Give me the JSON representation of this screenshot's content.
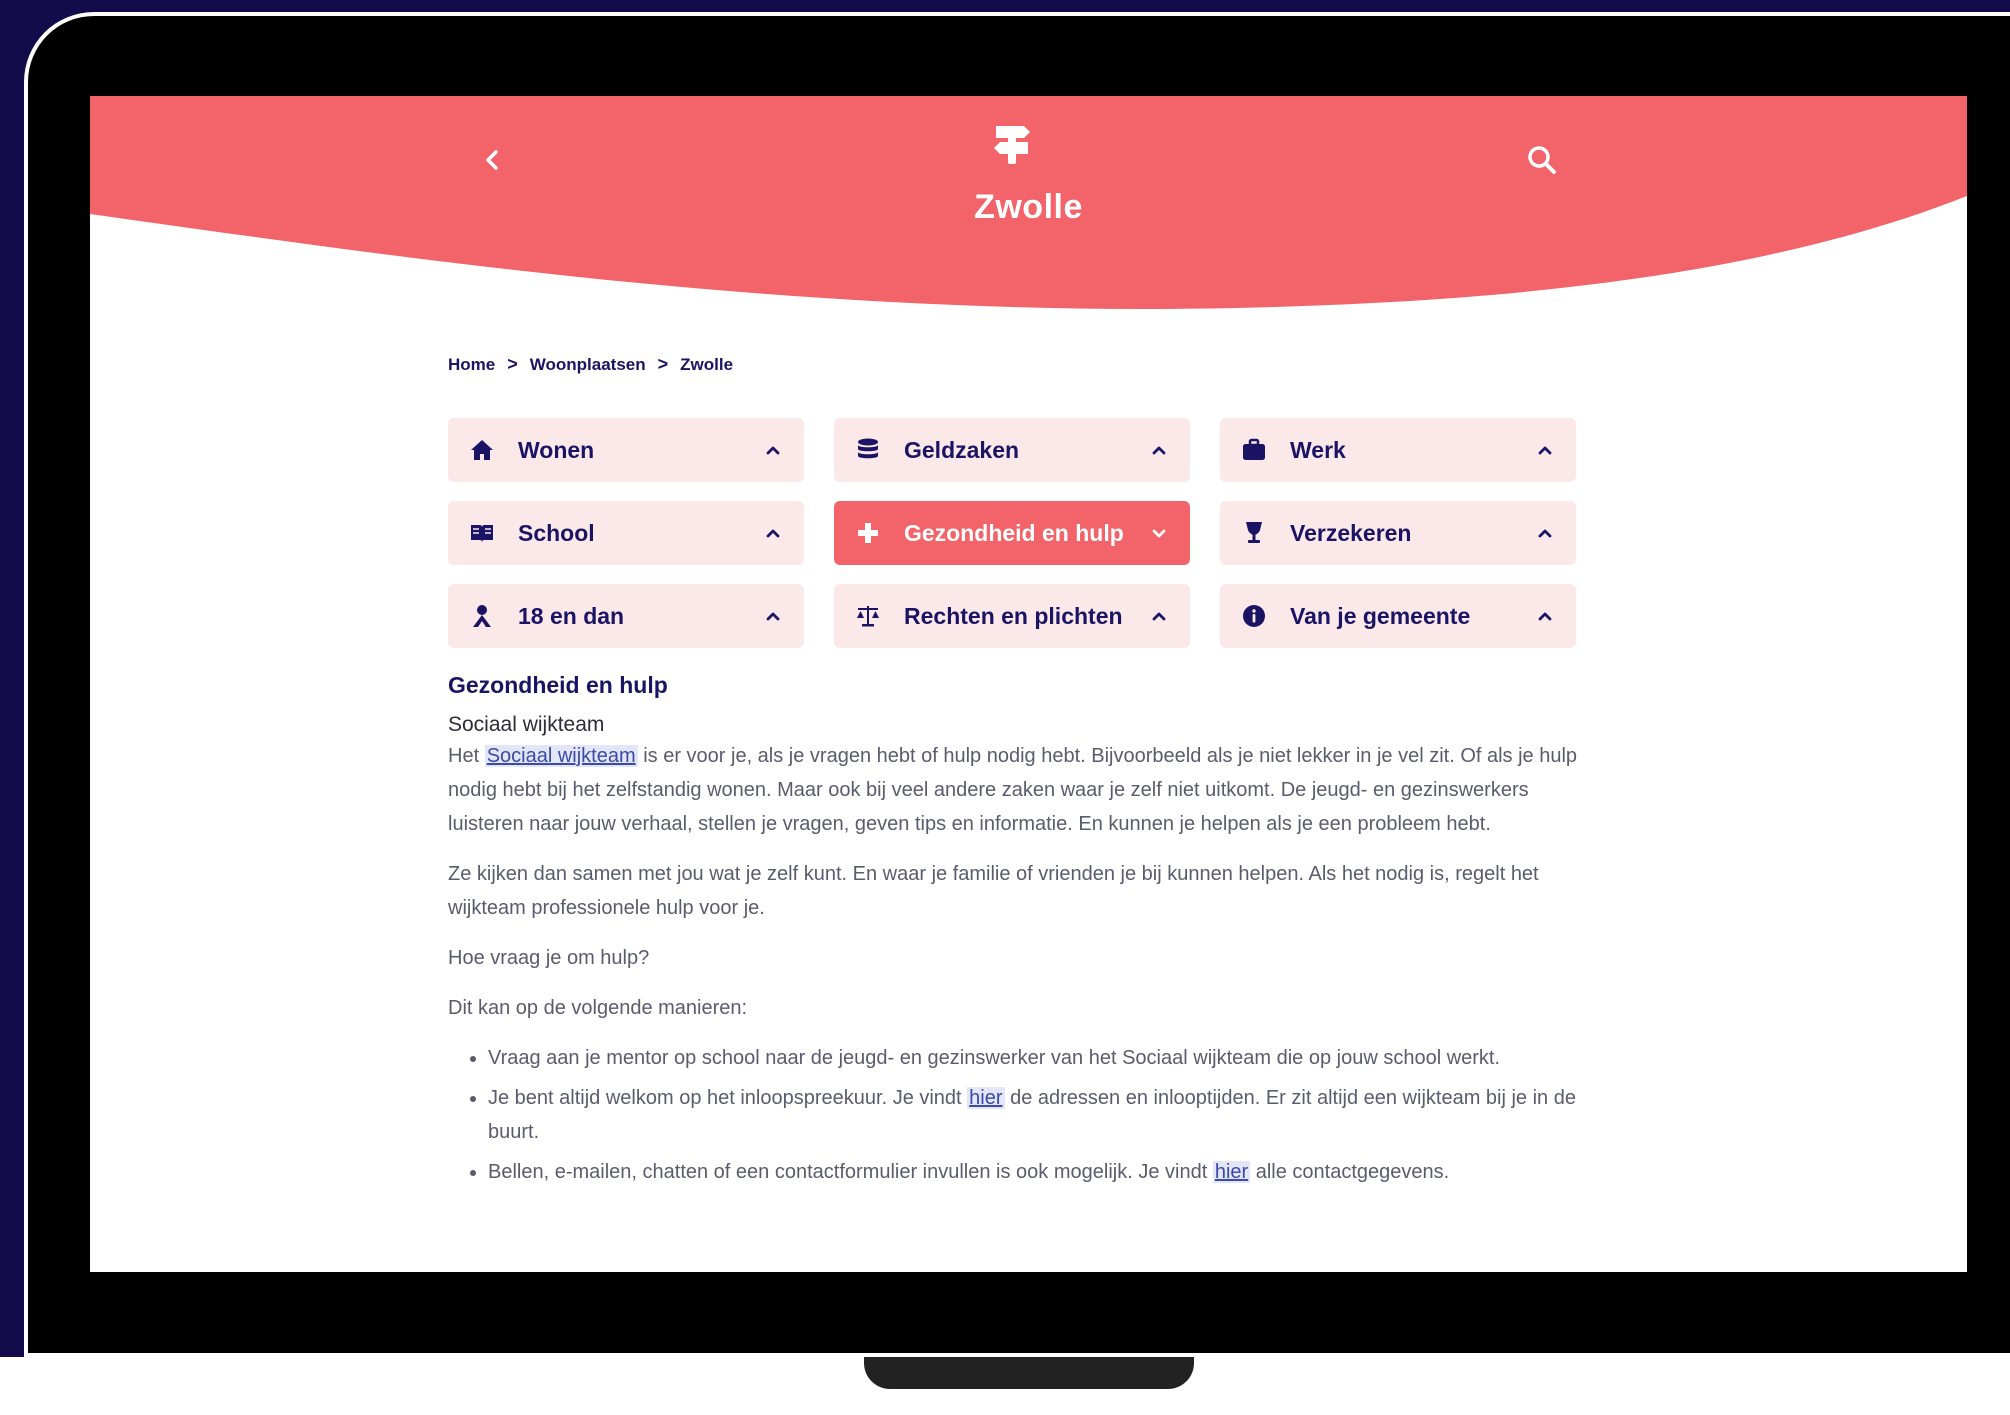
{
  "colors": {
    "brand": "#f2636a",
    "navy": "#1b1464",
    "tile_bg": "#fbe9ea",
    "backdrop": "#140c4a"
  },
  "header": {
    "title": "Zwolle",
    "back_icon": "chevron-left-icon",
    "logo_icon": "signpost-icon",
    "search_icon": "search-icon"
  },
  "breadcrumb": {
    "items": [
      "Home",
      "Woonplaatsen",
      "Zwolle"
    ],
    "separator": ">"
  },
  "categories": [
    {
      "label": "Wonen",
      "icon": "house-icon",
      "active": false
    },
    {
      "label": "Geldzaken",
      "icon": "coins-icon",
      "active": false
    },
    {
      "label": "Werk",
      "icon": "briefcase-icon",
      "active": false
    },
    {
      "label": "School",
      "icon": "book-icon",
      "active": false
    },
    {
      "label": "Gezondheid en hulp",
      "icon": "plus-icon",
      "active": true
    },
    {
      "label": "Verzekeren",
      "icon": "umbrella-icon",
      "active": false
    },
    {
      "label": "18 en dan",
      "icon": "person-icon",
      "active": false
    },
    {
      "label": "Rechten en plichten",
      "icon": "scale-icon",
      "active": false
    },
    {
      "label": "Van je gemeente",
      "icon": "info-icon",
      "active": false
    }
  ],
  "content": {
    "section_title": "Gezondheid en hulp",
    "sub_title": "Sociaal wijkteam",
    "p1_before": "Het ",
    "p1_link": "Sociaal wijkteam",
    "p1_after": " is er voor je, als je vragen hebt of hulp nodig hebt. Bijvoorbeeld als je niet lekker in je vel zit. Of als je hulp nodig hebt bij het zelfstandig wonen. Maar ook bij veel andere zaken waar je zelf niet uitkomt. De jeugd- en gezinswerkers luisteren naar jouw verhaal, stellen je vragen, geven tips en informatie. En kunnen je helpen als je een probleem hebt.",
    "p2": "Ze kijken dan samen met jou wat je zelf kunt. En waar je familie of vrienden je bij kunnen helpen. Als het nodig is, regelt het wijkteam professionele hulp voor je.",
    "p3": "Hoe vraag je om hulp?",
    "p4": "Dit kan op de volgende manieren:",
    "li1": "Vraag aan je mentor op school naar de jeugd- en gezinswerker van het Sociaal wijkteam die op jouw school werkt.",
    "li2_before": "Je bent altijd welkom op het inloopspreekuur. Je vindt ",
    "li2_link": "hier",
    "li2_after": " de adressen en inlooptijden. Er zit altijd een wijkteam bij je in de buurt.",
    "li3_before": "Bellen, e-mailen, chatten of een contactformulier invullen is ook mogelijk. Je vindt ",
    "li3_link": "hier",
    "li3_after": " alle contactgegevens."
  }
}
